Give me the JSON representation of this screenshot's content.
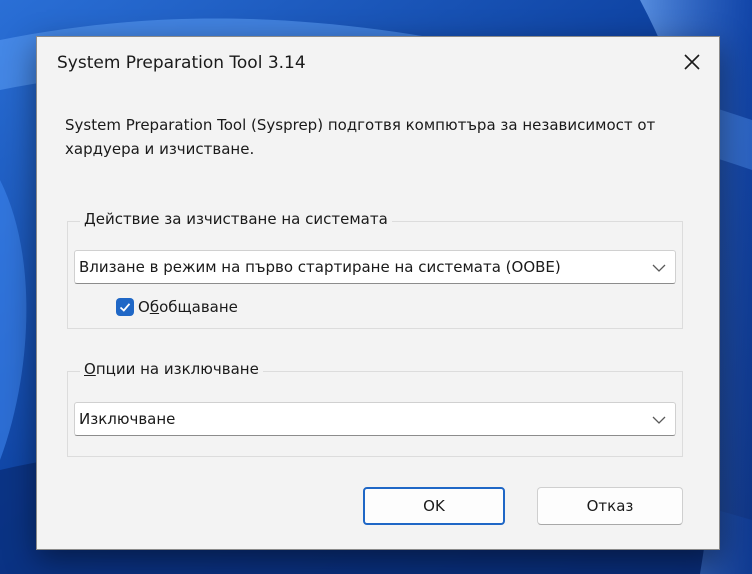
{
  "dialog": {
    "title": "System Preparation Tool 3.14",
    "description": "System Preparation Tool (Sysprep) подготвя компютъра за независимост от хардуера и изчистване."
  },
  "cleanup_group": {
    "legend_accel": "Д",
    "legend_rest": "ействие за изчистване на системата",
    "selected_value": "Влизане в режим на първо стартиране на системата (OOBE)",
    "generalize_checked": true,
    "generalize_pre": "О",
    "generalize_accel": "б",
    "generalize_post": "общаване"
  },
  "shutdown_group": {
    "legend_accel": "О",
    "legend_rest": "пции на изключване",
    "selected_value": "Изключване"
  },
  "buttons": {
    "ok": "OK",
    "cancel": "Отказ"
  },
  "colors": {
    "accent": "#1f67c6",
    "dialog_bg": "#f3f3f3"
  },
  "icons": [
    "close-icon",
    "chevron-down-icon",
    "checkmark-icon"
  ]
}
